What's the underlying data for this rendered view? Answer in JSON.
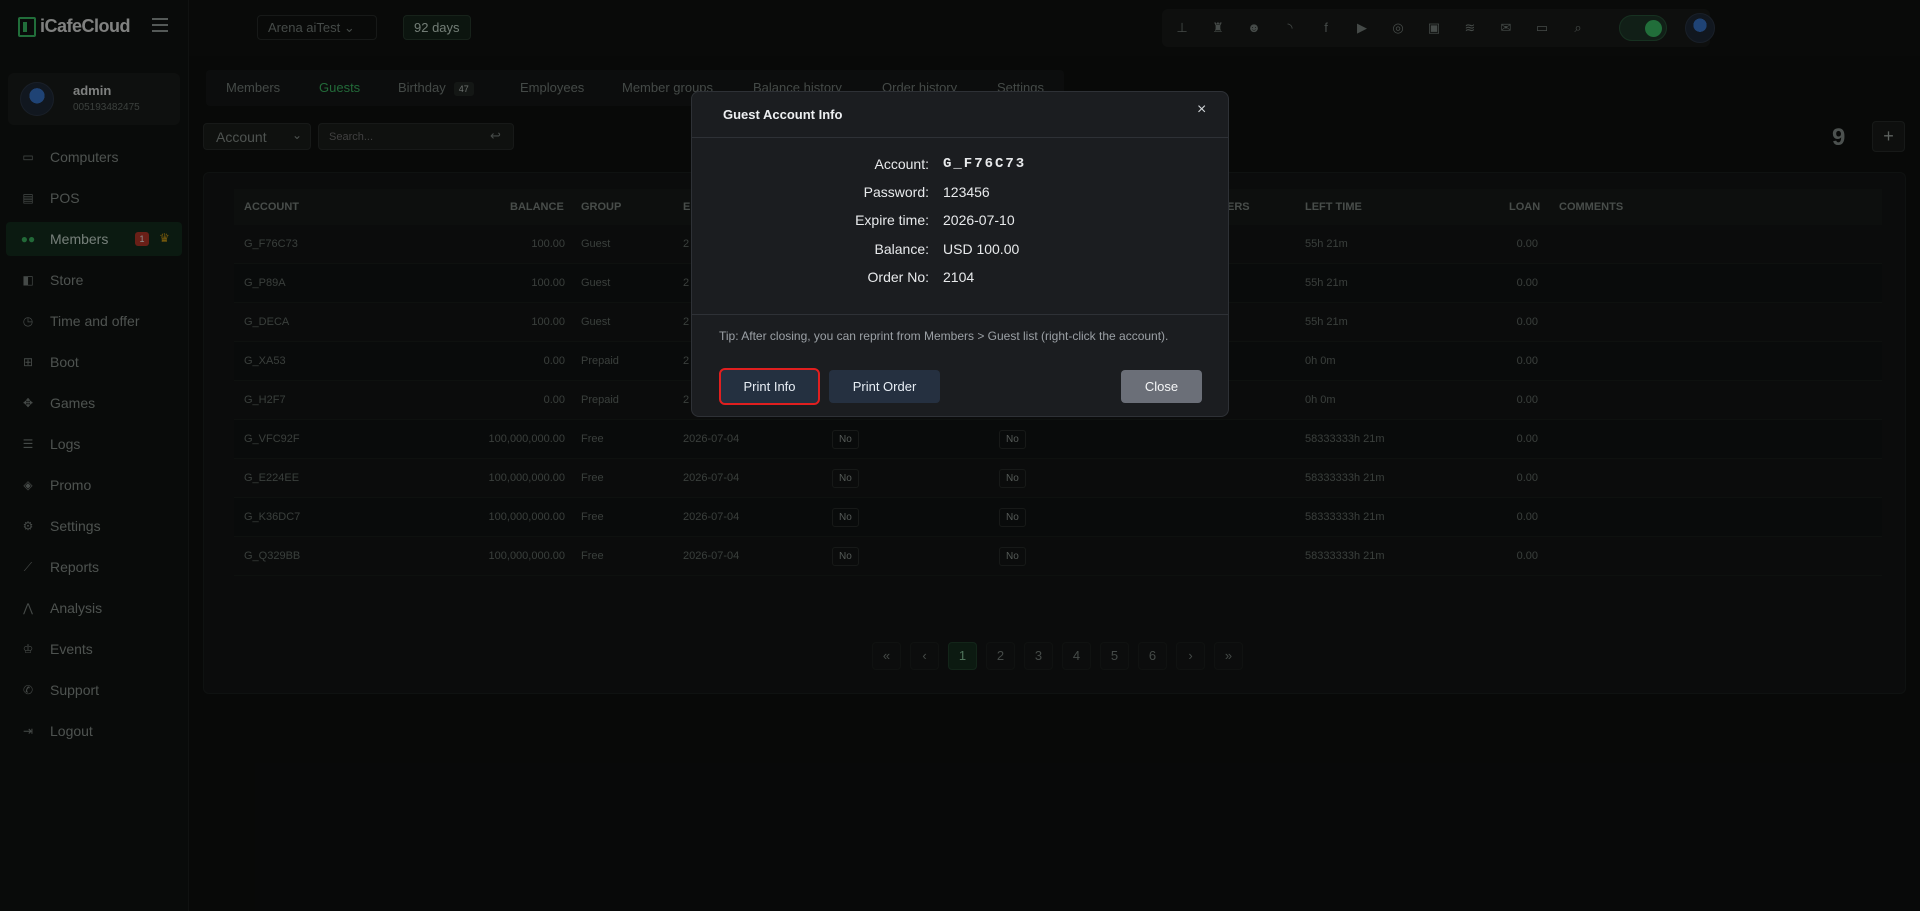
{
  "app": {
    "logo_text": "iCafeCloud"
  },
  "user": {
    "name": "admin",
    "id": "005193482475"
  },
  "sidebar": {
    "items": [
      {
        "label": "Computers",
        "icon": "monitor-icon"
      },
      {
        "label": "POS",
        "icon": "pos-icon"
      },
      {
        "label": "Members",
        "icon": "members-icon",
        "badge": "1"
      },
      {
        "label": "Store",
        "icon": "store-icon"
      },
      {
        "label": "Time and offer",
        "icon": "clock-icon"
      },
      {
        "label": "Boot",
        "icon": "windows-icon"
      },
      {
        "label": "Games",
        "icon": "gamepad-icon"
      },
      {
        "label": "Logs",
        "icon": "list-icon"
      },
      {
        "label": "Promo",
        "icon": "tag-icon"
      },
      {
        "label": "Settings",
        "icon": "gear-icon"
      },
      {
        "label": "Reports",
        "icon": "chart-icon"
      },
      {
        "label": "Analysis",
        "icon": "analysis-icon"
      },
      {
        "label": "Events",
        "icon": "crown-icon"
      },
      {
        "label": "Support",
        "icon": "phone-icon"
      },
      {
        "label": "Logout",
        "icon": "logout-icon"
      }
    ]
  },
  "topbar": {
    "venue": "Arena aiTest",
    "days": "92 days"
  },
  "tabs": [
    {
      "label": "Members"
    },
    {
      "label": "Guests",
      "active": true
    },
    {
      "label": "Birthday",
      "count": "47"
    },
    {
      "label": "Employees"
    },
    {
      "label": "Member groups"
    },
    {
      "label": "Balance history"
    },
    {
      "label": "Order history"
    },
    {
      "label": "Settings"
    }
  ],
  "filter": {
    "field": "Account",
    "search_placeholder": "Search..."
  },
  "total_count": "9",
  "table": {
    "headers": {
      "account": "ACCOUNT",
      "balance": "BALANCE",
      "group": "GROUP",
      "expire": "E",
      "members": "ERS",
      "left_time": "LEFT TIME",
      "loan": "LOAN",
      "comments": "COMMENTS"
    },
    "rows": [
      {
        "account": "G_F76C73",
        "balance": "100.00",
        "group": "Guest",
        "expire": "2",
        "c1": "",
        "c2": "",
        "left": "55h 21m",
        "loan": "0.00"
      },
      {
        "account": "G_P89A",
        "balance": "100.00",
        "group": "Guest",
        "expire": "2",
        "c1": "",
        "c2": "",
        "left": "55h 21m",
        "loan": "0.00"
      },
      {
        "account": "G_DECA",
        "balance": "100.00",
        "group": "Guest",
        "expire": "2",
        "c1": "",
        "c2": "",
        "left": "55h 21m",
        "loan": "0.00"
      },
      {
        "account": "G_XA53",
        "balance": "0.00",
        "group": "Prepaid",
        "expire": "2",
        "c1": "",
        "c2": "",
        "left": "0h 0m",
        "loan": "0.00"
      },
      {
        "account": "G_H2F7",
        "balance": "0.00",
        "group": "Prepaid",
        "expire": "2",
        "c1": "",
        "c2": "",
        "left": "0h 0m",
        "loan": "0.00"
      },
      {
        "account": "G_VFC92F",
        "balance": "100,000,000.00",
        "group": "Free",
        "expire": "2026-07-04",
        "c1": "No",
        "c2": "No",
        "left": "58333333h 21m",
        "loan": "0.00"
      },
      {
        "account": "G_E224EE",
        "balance": "100,000,000.00",
        "group": "Free",
        "expire": "2026-07-04",
        "c1": "No",
        "c2": "No",
        "left": "58333333h 21m",
        "loan": "0.00"
      },
      {
        "account": "G_K36DC7",
        "balance": "100,000,000.00",
        "group": "Free",
        "expire": "2026-07-04",
        "c1": "No",
        "c2": "No",
        "left": "58333333h 21m",
        "loan": "0.00"
      },
      {
        "account": "G_Q329BB",
        "balance": "100,000,000.00",
        "group": "Free",
        "expire": "2026-07-04",
        "c1": "No",
        "c2": "No",
        "left": "58333333h 21m",
        "loan": "0.00"
      }
    ]
  },
  "pagination": [
    "«",
    "‹",
    "1",
    "2",
    "3",
    "4",
    "5",
    "6",
    "›",
    "»"
  ],
  "modal": {
    "title": "Guest Account Info",
    "close_x": "×",
    "fields": [
      {
        "label": "Account:",
        "value": "G_F76C73"
      },
      {
        "label": "Password:",
        "value": "123456"
      },
      {
        "label": "Expire time:",
        "value": "2026-07-10"
      },
      {
        "label": "Balance:",
        "value": "USD 100.00"
      },
      {
        "label": "Order No:",
        "value": "2104"
      }
    ],
    "tip": "Tip: After closing, you can reprint from Members > Guest list (right-click the account).",
    "print_info": "Print Info",
    "print_order": "Print Order",
    "close": "Close"
  }
}
